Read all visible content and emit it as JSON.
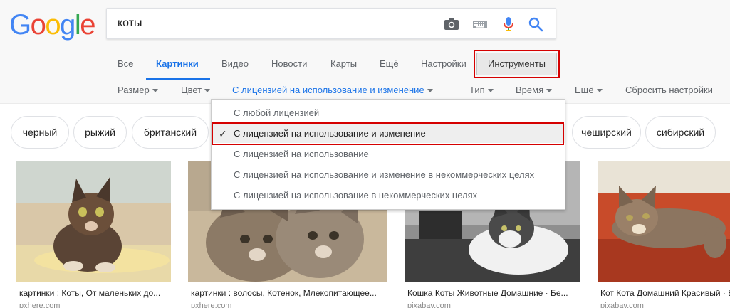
{
  "logo": {
    "letters": [
      "G",
      "o",
      "o",
      "g",
      "l",
      "e"
    ],
    "colors": [
      "#4285f4",
      "#ea4335",
      "#fbbc05",
      "#4285f4",
      "#34a853",
      "#ea4335"
    ]
  },
  "search": {
    "query": "коты"
  },
  "icons": {
    "camera": "camera-icon",
    "keyboard": "keyboard-icon",
    "mic": "mic-icon",
    "search": "search-icon"
  },
  "tabs": [
    {
      "label": "Все"
    },
    {
      "label": "Картинки",
      "active": true
    },
    {
      "label": "Видео"
    },
    {
      "label": "Новости"
    },
    {
      "label": "Карты"
    },
    {
      "label": "Ещё"
    },
    {
      "label": "Настройки"
    }
  ],
  "tools_label": "Инструменты",
  "filters": [
    {
      "label": "Размер"
    },
    {
      "label": "Цвет"
    },
    {
      "label": "С лицензией на использование и изменение",
      "selected": true
    },
    {
      "label": "Тип"
    },
    {
      "label": "Время"
    },
    {
      "label": "Ещё"
    }
  ],
  "reset_label": "Сбросить настройки",
  "chips": [
    "черный",
    "рыжий",
    "британский",
    "чеширский",
    "сибирский"
  ],
  "license_menu": {
    "items": [
      {
        "label": "С любой лицензией",
        "checked": false
      },
      {
        "label": "С лицензией на использование и изменение",
        "checked": true
      },
      {
        "label": "С лицензией на использование",
        "checked": false
      },
      {
        "label": "С лицензией на использование и изменение в некоммерческих целях",
        "checked": false
      },
      {
        "label": "С лицензией на использование в некоммерческих целях",
        "checked": false
      }
    ],
    "check_glyph": "✓"
  },
  "results": [
    {
      "caption": "картинки : Коты, От маленьких до...",
      "source": "pxhere.com"
    },
    {
      "caption": "картинки : волосы, Котенок, Млекопитающее...",
      "source": "pxhere.com"
    },
    {
      "caption": "Кошка Коты Животные Домашние · Бе...",
      "source": "pixabay.com"
    },
    {
      "caption": "Кот Кота Домашний Красивый · Бе...",
      "source": "pixabay.com"
    }
  ],
  "colors": {
    "accent": "#1a73e8",
    "highlight_frame": "#d50000"
  }
}
